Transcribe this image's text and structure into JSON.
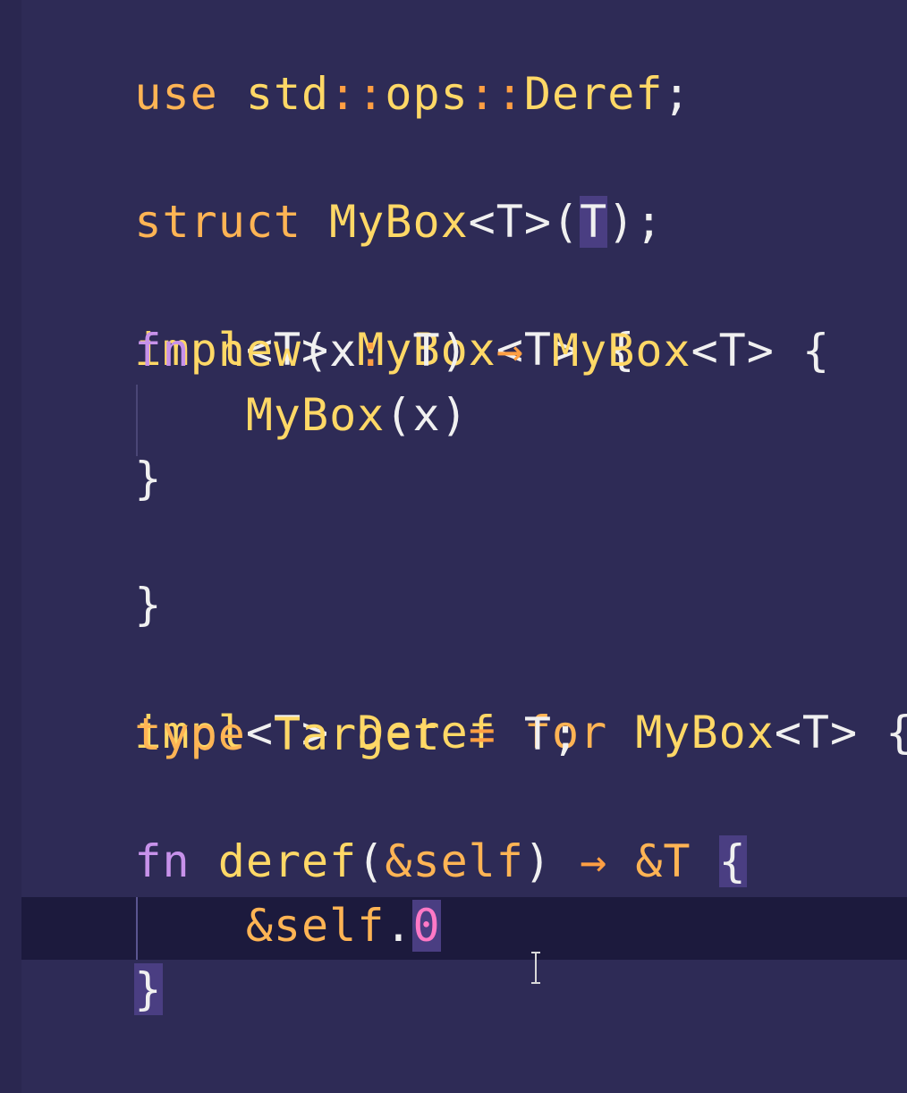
{
  "code": {
    "l1": {
      "use": "use",
      "path1": "std",
      "sep1": "::",
      "path2": "ops",
      "sep2": "::",
      "name": "Deref",
      "end": ";"
    },
    "l2": {
      "kw": "struct",
      "name": "MyBox",
      "generic": "<T>",
      "paren_open": "(",
      "inner": "T",
      "paren_close": ")",
      "end": ";"
    },
    "l3": {
      "kw": "impl",
      "generic": "<T>",
      "name": "MyBox",
      "generic2": "<T>",
      "brace": "{"
    },
    "l4": {
      "fn": "fn",
      "name": "new",
      "params_open": "(",
      "param": "x",
      "colon": ":",
      "ptype": "T",
      "params_close": ")",
      "arrow": "→",
      "ret": "MyBox",
      "ret_generic": "<T>",
      "brace": "{"
    },
    "l5": {
      "call": "MyBox",
      "open": "(",
      "arg": "x",
      "close": ")"
    },
    "l6": {
      "brace": "}"
    },
    "l7": {
      "brace": "}"
    },
    "l8": {
      "kw": "impl",
      "generic": "<T>",
      "trait": "Deref",
      "for": "for",
      "name": "MyBox",
      "generic2": "<T>",
      "brace": "{"
    },
    "l9": {
      "kw": "type",
      "name": "Target",
      "eq": "=",
      "val": "T",
      "end": ";"
    },
    "l10": {
      "fn": "fn",
      "name": "deref",
      "open": "(",
      "param": "&self",
      "close": ")",
      "arrow": "→",
      "ret": "&T",
      "brace": "{"
    },
    "l11": {
      "ref": "&self",
      "dot": ".",
      "field": "0"
    },
    "l12": {
      "brace": "}"
    },
    "l13": {
      "brace": "}"
    }
  },
  "cursor": {
    "icon": "text-cursor-icon"
  },
  "colors": {
    "background": "#2e2b56",
    "keyword": "#ffb454",
    "fn_keyword": "#c792ea",
    "type": "#ffd866",
    "number": "#ff79c6",
    "current_line": "#1c1a3d",
    "bracket_highlight": "#4a3e82"
  }
}
